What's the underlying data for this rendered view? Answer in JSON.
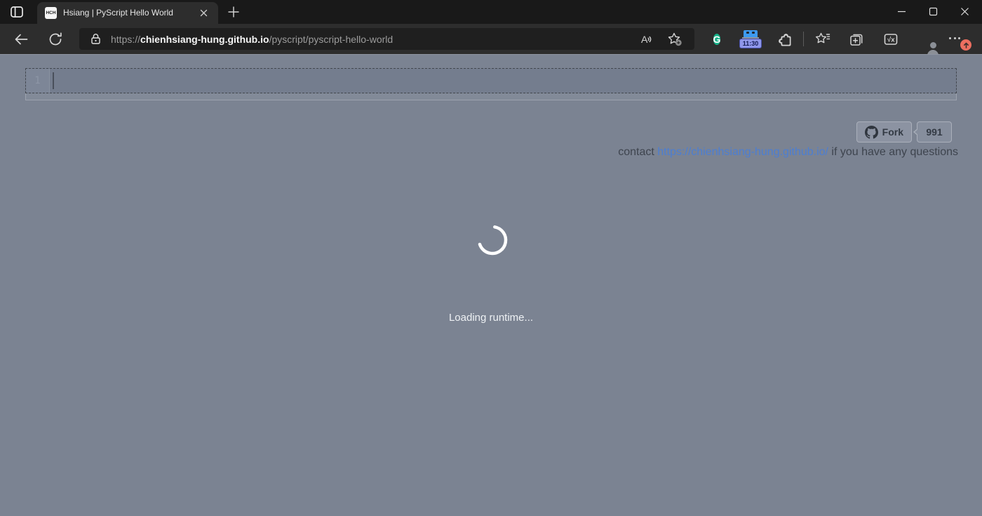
{
  "window": {
    "title_bar": {
      "tab_title": "Hsiang | PyScript Hello World",
      "favicon_text": "HCH"
    },
    "address_bar": {
      "url_scheme": "https://",
      "url_domain": "chienhsiang-hung.github.io",
      "url_path": "/pyscript/pyscript-hello-world"
    },
    "extensions": {
      "grammarly_letter": "G",
      "clock_badge": "11:30",
      "math_label": "√x"
    }
  },
  "page": {
    "editor": {
      "line_number": "1"
    },
    "fork_widget": {
      "label": "Fork",
      "count": "991"
    },
    "contact": {
      "prefix": "contact ",
      "link_text": "https://chienhsiang-hung.github.io/",
      "suffix": " if you have any questions"
    },
    "loading_text": "Loading runtime...",
    "colors": {
      "page_background": "#7b8392",
      "browser_chrome_dark": "#191919",
      "toolbar_dark": "#2d2d2d",
      "link_blue": "#4c7ed2",
      "update_badge_orange": "#ec6f60",
      "grammarly_green": "#16b288",
      "clock_icon_blue": "#3d9af0",
      "loading_text_color": "#eef1f4"
    }
  }
}
